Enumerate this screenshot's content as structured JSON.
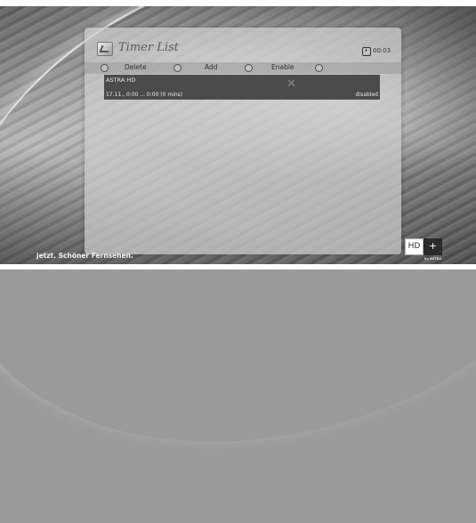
{
  "window": {
    "title": "Timer List",
    "clock": "00:03"
  },
  "buttons": [
    {
      "label": "Delete"
    },
    {
      "label": "Add"
    },
    {
      "label": "Enable"
    }
  ],
  "timers": [
    {
      "channel": "ASTRA HD",
      "schedule": "17.11., 0:00 ... 0:00 (0 mins)",
      "state": "disabled",
      "remove_icon": "close-icon"
    }
  ],
  "footer": {
    "slogan": "jetzt. Schöner Fernsehen.",
    "brand_hd": "HD",
    "brand_plus": "+",
    "brand_by": "by ASTRA"
  },
  "icons": {
    "title": "timer-list-icon",
    "clock": "clock-icon"
  }
}
